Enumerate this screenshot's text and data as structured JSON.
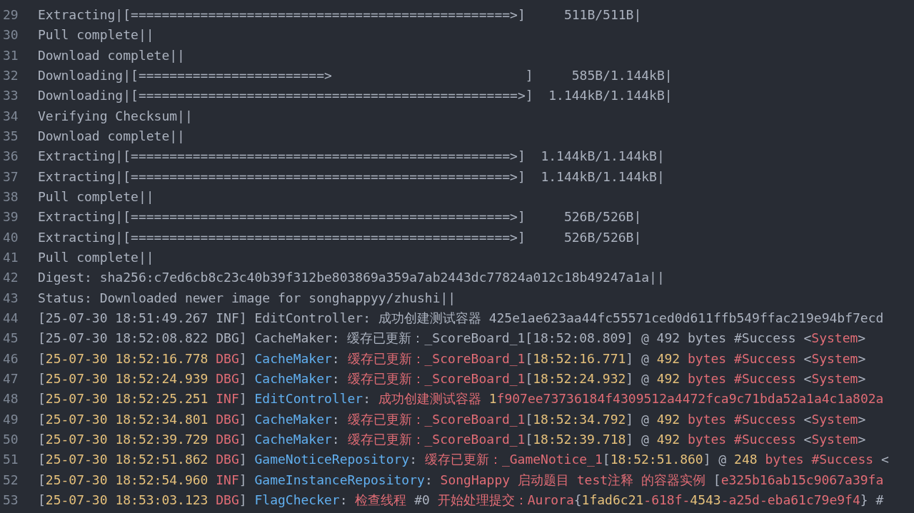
{
  "log_lines": [
    {
      "number": "29",
      "segments": [
        {
          "kind": "plain",
          "text": "Extracting|[=================================================>]     511B/511B|"
        }
      ]
    },
    {
      "number": "30",
      "segments": [
        {
          "kind": "plain",
          "text": "Pull complete||"
        }
      ]
    },
    {
      "number": "31",
      "segments": [
        {
          "kind": "plain",
          "text": "Download complete||"
        }
      ]
    },
    {
      "number": "32",
      "segments": [
        {
          "kind": "plain",
          "text": "Downloading|[========================>                         ]     585B/1.144kB|"
        }
      ]
    },
    {
      "number": "33",
      "segments": [
        {
          "kind": "plain",
          "text": "Downloading|[=================================================>]  1.144kB/1.144kB|"
        }
      ]
    },
    {
      "number": "34",
      "segments": [
        {
          "kind": "plain",
          "text": "Verifying Checksum||"
        }
      ]
    },
    {
      "number": "35",
      "segments": [
        {
          "kind": "plain",
          "text": "Download complete||"
        }
      ]
    },
    {
      "number": "36",
      "segments": [
        {
          "kind": "plain",
          "text": "Extracting|[=================================================>]  1.144kB/1.144kB|"
        }
      ]
    },
    {
      "number": "37",
      "segments": [
        {
          "kind": "plain",
          "text": "Extracting|[=================================================>]  1.144kB/1.144kB|"
        }
      ]
    },
    {
      "number": "38",
      "segments": [
        {
          "kind": "plain",
          "text": "Pull complete||"
        }
      ]
    },
    {
      "number": "39",
      "segments": [
        {
          "kind": "plain",
          "text": "Extracting|[=================================================>]     526B/526B|"
        }
      ]
    },
    {
      "number": "40",
      "segments": [
        {
          "kind": "plain",
          "text": "Extracting|[=================================================>]     526B/526B|"
        }
      ]
    },
    {
      "number": "41",
      "segments": [
        {
          "kind": "plain",
          "text": "Pull complete||"
        }
      ]
    },
    {
      "number": "42",
      "segments": [
        {
          "kind": "plain",
          "text": "Digest: sha256:c7ed6cb8c23c40b39f312be803869a359a7ab2443dc77824a012c18b49247a1a||"
        }
      ]
    },
    {
      "number": "43",
      "segments": [
        {
          "kind": "plain",
          "text": "Status: Downloaded newer image for songhappyy/zhushi||"
        }
      ]
    },
    {
      "number": "44",
      "segments": [
        {
          "kind": "plain",
          "text": "[25-07-30 18:51:49.267 INF] EditController: 成功创建测试容器 425e1ae623aa44fc55571ced0d611ffb549ffac219e94bf7ecd"
        }
      ]
    },
    {
      "number": "45",
      "segments": [
        {
          "kind": "plain",
          "text": "[25-07-30 18:52:08.822 DBG] CacheMaker: 缓存已更新：_ScoreBoard_1[18:52:08.809] @ 492 bytes #Success <"
        },
        {
          "kind": "message",
          "text": "System"
        },
        {
          "kind": "plain",
          "text": ">"
        }
      ]
    },
    {
      "number": "46",
      "segments": [
        {
          "kind": "plain",
          "text": "["
        },
        {
          "kind": "number",
          "text": "25-07-30 18:52:16.778"
        },
        {
          "kind": "level",
          "text": " DBG"
        },
        {
          "kind": "plain",
          "text": "] "
        },
        {
          "kind": "source",
          "text": "CacheMaker"
        },
        {
          "kind": "plain",
          "text": ": "
        },
        {
          "kind": "message",
          "text": "缓存已更新：_ScoreBoard_1"
        },
        {
          "kind": "plain",
          "text": "["
        },
        {
          "kind": "number",
          "text": "18:52:16.771"
        },
        {
          "kind": "plain",
          "text": "] @ "
        },
        {
          "kind": "number",
          "text": "492"
        },
        {
          "kind": "message",
          "text": " bytes #Success "
        },
        {
          "kind": "plain",
          "text": "<"
        },
        {
          "kind": "message",
          "text": "System"
        },
        {
          "kind": "plain",
          "text": ">"
        }
      ]
    },
    {
      "number": "47",
      "segments": [
        {
          "kind": "plain",
          "text": "["
        },
        {
          "kind": "number",
          "text": "25-07-30 18:52:24.939"
        },
        {
          "kind": "level",
          "text": " DBG"
        },
        {
          "kind": "plain",
          "text": "] "
        },
        {
          "kind": "source",
          "text": "CacheMaker"
        },
        {
          "kind": "plain",
          "text": ": "
        },
        {
          "kind": "message",
          "text": "缓存已更新：_ScoreBoard_1"
        },
        {
          "kind": "plain",
          "text": "["
        },
        {
          "kind": "number",
          "text": "18:52:24.932"
        },
        {
          "kind": "plain",
          "text": "] @ "
        },
        {
          "kind": "number",
          "text": "492"
        },
        {
          "kind": "message",
          "text": " bytes #Success "
        },
        {
          "kind": "plain",
          "text": "<"
        },
        {
          "kind": "message",
          "text": "System"
        },
        {
          "kind": "plain",
          "text": ">"
        }
      ]
    },
    {
      "number": "48",
      "segments": [
        {
          "kind": "plain",
          "text": "["
        },
        {
          "kind": "number",
          "text": "25-07-30 18:52:25.251"
        },
        {
          "kind": "level",
          "text": " INF"
        },
        {
          "kind": "plain",
          "text": "] "
        },
        {
          "kind": "source",
          "text": "EditController"
        },
        {
          "kind": "plain",
          "text": ": "
        },
        {
          "kind": "message",
          "text": "成功创建测试容器 "
        },
        {
          "kind": "number",
          "text": "1"
        },
        {
          "kind": "message",
          "text": "f907ee73736184f4309512a4472fca9c71bda52a1a4c1a802a"
        }
      ]
    },
    {
      "number": "49",
      "segments": [
        {
          "kind": "plain",
          "text": "["
        },
        {
          "kind": "number",
          "text": "25-07-30 18:52:34.801"
        },
        {
          "kind": "level",
          "text": " DBG"
        },
        {
          "kind": "plain",
          "text": "] "
        },
        {
          "kind": "source",
          "text": "CacheMaker"
        },
        {
          "kind": "plain",
          "text": ": "
        },
        {
          "kind": "message",
          "text": "缓存已更新：_ScoreBoard_1"
        },
        {
          "kind": "plain",
          "text": "["
        },
        {
          "kind": "number",
          "text": "18:52:34.792"
        },
        {
          "kind": "plain",
          "text": "] @ "
        },
        {
          "kind": "number",
          "text": "492"
        },
        {
          "kind": "message",
          "text": " bytes #Success "
        },
        {
          "kind": "plain",
          "text": "<"
        },
        {
          "kind": "message",
          "text": "System"
        },
        {
          "kind": "plain",
          "text": ">"
        }
      ]
    },
    {
      "number": "50",
      "segments": [
        {
          "kind": "plain",
          "text": "["
        },
        {
          "kind": "number",
          "text": "25-07-30 18:52:39.729"
        },
        {
          "kind": "level",
          "text": " DBG"
        },
        {
          "kind": "plain",
          "text": "] "
        },
        {
          "kind": "source",
          "text": "CacheMaker"
        },
        {
          "kind": "plain",
          "text": ": "
        },
        {
          "kind": "message",
          "text": "缓存已更新：_ScoreBoard_1"
        },
        {
          "kind": "plain",
          "text": "["
        },
        {
          "kind": "number",
          "text": "18:52:39.718"
        },
        {
          "kind": "plain",
          "text": "] @ "
        },
        {
          "kind": "number",
          "text": "492"
        },
        {
          "kind": "message",
          "text": " bytes #Success "
        },
        {
          "kind": "plain",
          "text": "<"
        },
        {
          "kind": "message",
          "text": "System"
        },
        {
          "kind": "plain",
          "text": ">"
        }
      ]
    },
    {
      "number": "51",
      "segments": [
        {
          "kind": "plain",
          "text": "["
        },
        {
          "kind": "number",
          "text": "25-07-30 18:52:51.862"
        },
        {
          "kind": "level",
          "text": " DBG"
        },
        {
          "kind": "plain",
          "text": "] "
        },
        {
          "kind": "source",
          "text": "GameNoticeRepository"
        },
        {
          "kind": "plain",
          "text": ": "
        },
        {
          "kind": "message",
          "text": "缓存已更新：_GameNotice_1"
        },
        {
          "kind": "plain",
          "text": "["
        },
        {
          "kind": "number",
          "text": "18:52:51.860"
        },
        {
          "kind": "plain",
          "text": "] @ "
        },
        {
          "kind": "number",
          "text": "248"
        },
        {
          "kind": "message",
          "text": " bytes #Success "
        },
        {
          "kind": "plain",
          "text": "<"
        }
      ]
    },
    {
      "number": "52",
      "segments": [
        {
          "kind": "plain",
          "text": "["
        },
        {
          "kind": "number",
          "text": "25-07-30 18:52:54.960"
        },
        {
          "kind": "level",
          "text": " INF"
        },
        {
          "kind": "plain",
          "text": "] "
        },
        {
          "kind": "source",
          "text": "GameInstanceRepository"
        },
        {
          "kind": "plain",
          "text": ": "
        },
        {
          "kind": "message",
          "text": "SongHappy 启动题目 test注释 的容器实例 "
        },
        {
          "kind": "plain",
          "text": "["
        },
        {
          "kind": "message",
          "text": "e325b16ab15c9067a39fa"
        }
      ]
    },
    {
      "number": "53",
      "segments": [
        {
          "kind": "plain",
          "text": "["
        },
        {
          "kind": "number",
          "text": "25-07-30 18:53:03.123"
        },
        {
          "kind": "level",
          "text": " DBG"
        },
        {
          "kind": "plain",
          "text": "] "
        },
        {
          "kind": "source",
          "text": "FlagChecker"
        },
        {
          "kind": "plain",
          "text": ": "
        },
        {
          "kind": "message",
          "text": "检查线程 "
        },
        {
          "kind": "plain",
          "text": "#0"
        },
        {
          "kind": "message",
          "text": " 开始处理提交：Aurora"
        },
        {
          "kind": "plain",
          "text": "{"
        },
        {
          "kind": "number",
          "text": "1fad6c21"
        },
        {
          "kind": "message",
          "text": "-618f-"
        },
        {
          "kind": "number",
          "text": "4543"
        },
        {
          "kind": "message",
          "text": "-a25d-eba61c79e9f4"
        },
        {
          "kind": "plain",
          "text": "} #"
        }
      ]
    }
  ]
}
